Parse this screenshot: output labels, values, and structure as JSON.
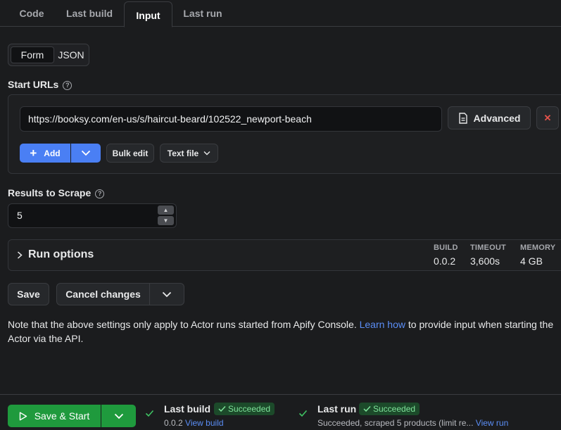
{
  "tabs": [
    {
      "label": "Code"
    },
    {
      "label": "Last build"
    },
    {
      "label": "Input"
    },
    {
      "label": "Last run"
    }
  ],
  "input_mode": {
    "form": "Form",
    "json": "JSON"
  },
  "start_urls": {
    "label": "Start URLs",
    "help": "?",
    "url_value": "https://booksy.com/en-us/s/haircut-beard/102522_newport-beach",
    "advanced_label": "Advanced",
    "remove_icon": "✕",
    "add_label": "Add",
    "bulk_edit_label": "Bulk edit",
    "text_file_label": "Text file"
  },
  "results": {
    "label": "Results to Scrape",
    "help": "?",
    "value": "5"
  },
  "run_options": {
    "label": "Run options",
    "build_head": "BUILD",
    "build_val": "0.0.2",
    "timeout_head": "TIMEOUT",
    "timeout_val": "3,600s",
    "memory_head": "MEMORY",
    "memory_val": "4 GB"
  },
  "actions": {
    "save_label": "Save",
    "cancel_label": "Cancel changes"
  },
  "note": {
    "text_before": "Note that the above settings only apply to Actor runs started from Apify Console. ",
    "link": "Learn how",
    "text_after": " to provide input when starting the Actor via the API."
  },
  "footer": {
    "save_start_label": "Save & Start",
    "last_build_title": "Last build",
    "last_build_status": "Succeeded",
    "last_build_version": "0.0.2",
    "view_build": "View build",
    "last_run_title": "Last run",
    "last_run_status": "Succeeded",
    "last_run_detail": "Succeeded, scraped 5 products (limit re...",
    "view_run": "View run"
  },
  "colors": {
    "background": "#1b1c1e",
    "primary_blue": "#4a7ff4",
    "success_green": "#1f9a3d",
    "link": "#5b8ef6",
    "danger": "#e5534b"
  }
}
